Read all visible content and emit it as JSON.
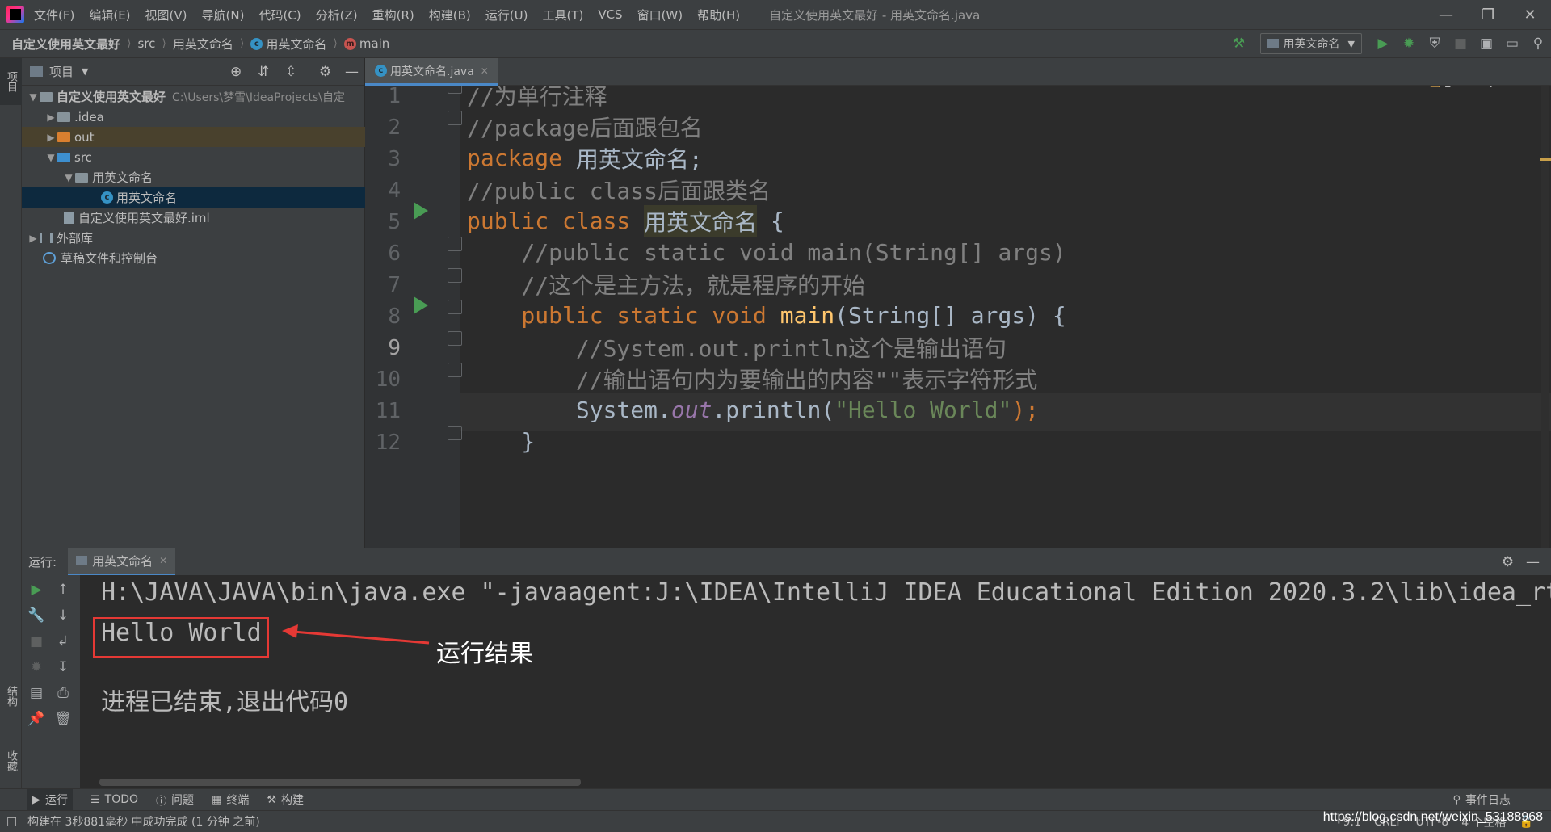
{
  "menu": {
    "items": [
      "文件(F)",
      "编辑(E)",
      "视图(V)",
      "导航(N)",
      "代码(C)",
      "分析(Z)",
      "重构(R)",
      "构建(B)",
      "运行(U)",
      "工具(T)",
      "VCS",
      "窗口(W)",
      "帮助(H)"
    ],
    "window_title": "自定义使用英文最好 - 用英文命名.java"
  },
  "breadcrumb": {
    "project": "自定义使用英文最好",
    "src": "src",
    "package": "用英文命名",
    "class": "用英文命名",
    "method": "main"
  },
  "toolbar": {
    "run_config": "用英文命名"
  },
  "stripe": {
    "project_label": "项目",
    "structure_label": "结构",
    "favorites_label": "收藏"
  },
  "project": {
    "title": "项目",
    "tree": [
      {
        "label": "自定义使用英文最好",
        "path": "C:\\Users\\梦雪\\IdeaProjects\\自定"
      },
      {
        "label": ".idea"
      },
      {
        "label": "out"
      },
      {
        "label": "src"
      },
      {
        "label": "用英文命名"
      },
      {
        "label": "用英文命名"
      },
      {
        "label": "自定义使用英文最好.iml"
      },
      {
        "label": "外部库"
      },
      {
        "label": "草稿文件和控制台"
      }
    ]
  },
  "editor": {
    "tab": "用英文命名.java",
    "inspection_count": "1",
    "line_numbers": [
      "1",
      "2",
      "3",
      "4",
      "5",
      "6",
      "7",
      "8",
      "9",
      "10",
      "11",
      "12"
    ],
    "lines": {
      "l1": "//为单行注释",
      "l2": "//package后面跟包名",
      "l3_kw": "package",
      "l3_rest": " 用英文命名;",
      "l4": "//public class后面跟类名",
      "l5_kw": "public class ",
      "l5_name": "用英文命名",
      "l5_rest": " {",
      "l6": "    //public static void main(String[] args)",
      "l7": "    //这个是主方法，就是程序的开始",
      "l8_kw": "    public static void ",
      "l8_fn": "main",
      "l8_rest": "(String[] args) {",
      "l9": "        //System.out.println这个是输出语句",
      "l10": "        //输出语句内为要输出的内容\"\"表示字符形式",
      "l11_a": "        System.",
      "l11_fld": "out",
      "l11_b": ".println(",
      "l11_str": "\"Hello World\"",
      "l11_c": ");",
      "l12": "    }"
    }
  },
  "run": {
    "title": "运行:",
    "tab": "用英文命名",
    "console": {
      "cmd": "H:\\JAVA\\JAVA\\bin\\java.exe \"-javaagent:J:\\IDEA\\IntelliJ IDEA Educational Edition 2020.3.2\\lib\\idea_rt",
      "output": "Hello World",
      "exit": "进程已结束,退出代码0"
    },
    "annotation": "运行结果"
  },
  "bottom_tabs": [
    "运行",
    "TODO",
    "问题",
    "终端",
    "构建"
  ],
  "event_log": "事件日志",
  "status": {
    "message": "构建在 3秒881毫秒 中成功完成 (1 分钟 之前)",
    "position": "9:1",
    "line_sep": "CRLF",
    "encoding": "UTF-8",
    "indent": "4 个空格"
  },
  "watermark": "https://blog.csdn.net/weixin_53188968",
  "colors": {
    "keyword": "#cc7832",
    "comment": "#808080",
    "string": "#6a8759",
    "static_field": "#9876aa",
    "method": "#ffc66d",
    "annotation_box": "#e53935",
    "run_green": "#499c54"
  }
}
